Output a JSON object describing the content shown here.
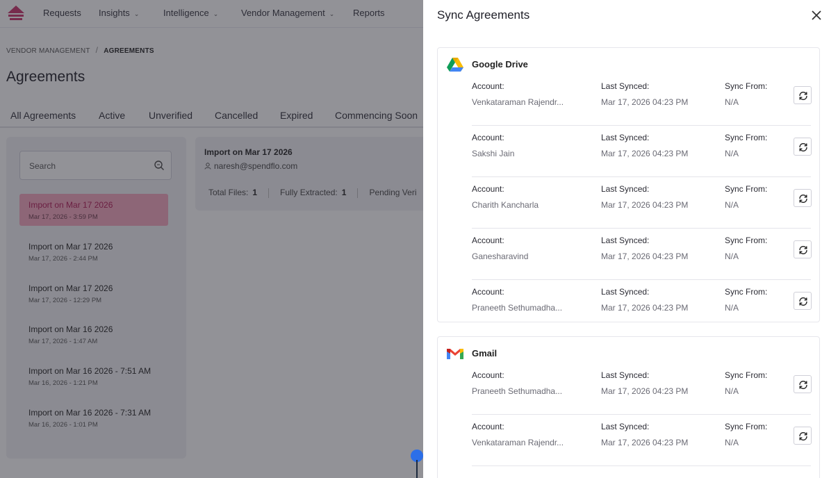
{
  "nav": {
    "items": [
      {
        "label": "Requests",
        "dropdown": false
      },
      {
        "label": "Insights",
        "dropdown": true
      },
      {
        "label": "Intelligence",
        "dropdown": true
      },
      {
        "label": "Vendor Management",
        "dropdown": true
      },
      {
        "label": "Reports",
        "dropdown": false
      }
    ],
    "brand_color": "#c8326a"
  },
  "breadcrumb": {
    "parent": "VENDOR MANAGEMENT",
    "separator": "/",
    "current": "AGREEMENTS"
  },
  "page_title": "Agreements",
  "tabs": [
    "All Agreements",
    "Active",
    "Unverified",
    "Cancelled",
    "Expired",
    "Commencing Soon"
  ],
  "search": {
    "placeholder": "Search"
  },
  "imports": [
    {
      "title": "Import on Mar 17 2026",
      "date": "Mar 17, 2026 - 3:59 PM",
      "selected": true
    },
    {
      "title": "Import on Mar 17 2026",
      "date": "Mar 17, 2026 - 2:44 PM",
      "selected": false
    },
    {
      "title": "Import on Mar 17 2026",
      "date": "Mar 17, 2026 - 12:29 PM",
      "selected": false
    },
    {
      "title": "Import on Mar 16 2026",
      "date": "Mar 17, 2026 - 1:47 AM",
      "selected": false
    },
    {
      "title": "Import on Mar 16 2026 - 7:51 AM",
      "date": "Mar 16, 2026 - 1:21 PM",
      "selected": false
    },
    {
      "title": "Import on Mar 16 2026 - 7:31 AM",
      "date": "Mar 16, 2026 - 1:01 PM",
      "selected": false
    }
  ],
  "detail": {
    "title": "Import on Mar 17 2026",
    "email": "naresh@spendflo.com",
    "total_files_label": "Total Files:",
    "total_files": "1",
    "fully_extracted_label": "Fully Extracted:",
    "fully_extracted": "1",
    "pending_label": "Pending Veri"
  },
  "drawer": {
    "title": "Sync Agreements",
    "labels": {
      "account": "Account:",
      "last_synced": "Last Synced:",
      "sync_from": "Sync From:"
    },
    "providers": [
      {
        "name": "Google Drive",
        "icon": "google-drive-icon",
        "accounts": [
          {
            "account": "Venkataraman Rajendr...",
            "last_synced": "Mar 17, 2026 04:23 PM",
            "sync_from": "N/A"
          },
          {
            "account": "Sakshi Jain",
            "last_synced": "Mar 17, 2026 04:23 PM",
            "sync_from": "N/A"
          },
          {
            "account": "Charith Kancharla",
            "last_synced": "Mar 17, 2026 04:23 PM",
            "sync_from": "N/A"
          },
          {
            "account": "Ganesharavind",
            "last_synced": "Mar 17, 2026 04:23 PM",
            "sync_from": "N/A"
          },
          {
            "account": "Praneeth Sethumadha...",
            "last_synced": "Mar 17, 2026 04:23 PM",
            "sync_from": "N/A"
          }
        ]
      },
      {
        "name": "Gmail",
        "icon": "gmail-icon",
        "accounts": [
          {
            "account": "Praneeth Sethumadha...",
            "last_synced": "Mar 17, 2026 04:23 PM",
            "sync_from": "N/A"
          },
          {
            "account": "Venkataraman Rajendr...",
            "last_synced": "Mar 17, 2026 04:23 PM",
            "sync_from": "N/A"
          }
        ]
      }
    ]
  }
}
